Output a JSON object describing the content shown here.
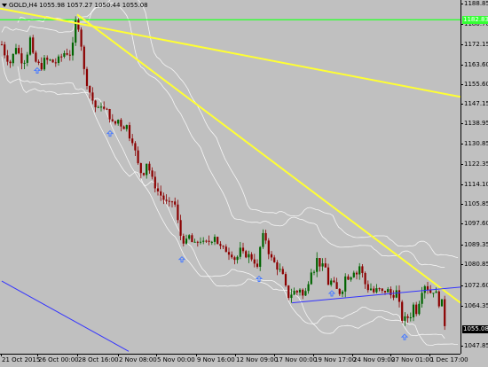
{
  "header": {
    "symbol_label": "GOLD,H4",
    "ohlc": "1055.98 1057.27 1050.44 1055.08"
  },
  "price_axis": {
    "ticks": [
      "1188.85",
      "1180.70",
      "1172.15",
      "1163.60",
      "1155.60",
      "1147.15",
      "1138.95",
      "1130.85",
      "1122.35",
      "1114.10",
      "1105.85",
      "1097.60",
      "1089.35",
      "1080.85",
      "1072.60",
      "1064.35",
      "1055.08",
      "1047.85"
    ],
    "badge_green": "1182.83",
    "badge_current": "1055.08"
  },
  "time_axis": {
    "labels": [
      "21 Oct 2015",
      "26 Oct 00:00",
      "28 Oct 16:00",
      "2 Nov 08:00",
      "5 Nov 00:00",
      "9 Nov 16:00",
      "12 Nov 09:00",
      "17 Nov 00:00",
      "19 Nov 17:00",
      "24 Nov 09:00",
      "27 Nov 01:00",
      "1 Dec 17:00"
    ]
  },
  "colors": {
    "background": "#c0c0c0",
    "bull_candle": "#006400",
    "bear_candle": "#8b0000",
    "trendline": "#ffff33",
    "horizontal_level": "#33ff33",
    "channel_line": "#3333ff",
    "bands": "#ffffff",
    "fractal_arrow": "#4a7cff"
  },
  "chart_data": {
    "type": "candlestick",
    "symbol": "GOLD",
    "timeframe": "H4",
    "ylim": [
      1045,
      1191
    ],
    "last_price": 1055.08,
    "horizontal_level": 1182.83,
    "path_points": [
      [
        0,
        1175
      ],
      [
        6,
        1168
      ],
      [
        12,
        1165
      ],
      [
        18,
        1172
      ],
      [
        22,
        1168
      ],
      [
        26,
        1165
      ],
      [
        30,
        1168
      ],
      [
        34,
        1175
      ],
      [
        38,
        1166
      ],
      [
        42,
        1165
      ],
      [
        46,
        1163
      ],
      [
        50,
        1166
      ],
      [
        56,
        1166
      ],
      [
        62,
        1165
      ],
      [
        68,
        1167
      ],
      [
        74,
        1170
      ],
      [
        78,
        1168
      ],
      [
        82,
        1172
      ],
      [
        85,
        1182
      ],
      [
        88,
        1181
      ],
      [
        91,
        1175
      ],
      [
        94,
        1163
      ],
      [
        98,
        1157
      ],
      [
        102,
        1152
      ],
      [
        106,
        1148
      ],
      [
        110,
        1145
      ],
      [
        114,
        1148
      ],
      [
        118,
        1145
      ],
      [
        122,
        1145
      ],
      [
        126,
        1140
      ],
      [
        130,
        1140
      ],
      [
        134,
        1142
      ],
      [
        138,
        1138
      ],
      [
        142,
        1140
      ],
      [
        146,
        1135
      ],
      [
        150,
        1133
      ],
      [
        154,
        1125
      ],
      [
        158,
        1120
      ],
      [
        162,
        1120
      ],
      [
        166,
        1125
      ],
      [
        170,
        1118
      ],
      [
        174,
        1115
      ],
      [
        178,
        1112
      ],
      [
        182,
        1110
      ],
      [
        186,
        1108
      ],
      [
        190,
        1106
      ],
      [
        194,
        1108
      ],
      [
        198,
        1106
      ],
      [
        202,
        1095
      ],
      [
        206,
        1092
      ],
      [
        210,
        1091
      ],
      [
        214,
        1094
      ],
      [
        218,
        1089
      ],
      [
        222,
        1091
      ],
      [
        226,
        1092
      ],
      [
        230,
        1090
      ],
      [
        234,
        1091
      ],
      [
        238,
        1092
      ],
      [
        242,
        1094
      ],
      [
        246,
        1090
      ],
      [
        250,
        1088
      ],
      [
        254,
        1088
      ],
      [
        258,
        1087
      ],
      [
        262,
        1086
      ],
      [
        266,
        1083
      ],
      [
        270,
        1088
      ],
      [
        274,
        1086
      ],
      [
        278,
        1086
      ],
      [
        282,
        1085
      ],
      [
        286,
        1084
      ],
      [
        290,
        1080
      ],
      [
        294,
        1091
      ],
      [
        298,
        1095
      ],
      [
        302,
        1088
      ],
      [
        306,
        1084
      ],
      [
        310,
        1082
      ],
      [
        314,
        1080
      ],
      [
        318,
        1078
      ],
      [
        322,
        1072
      ],
      [
        326,
        1068
      ],
      [
        330,
        1071
      ],
      [
        334,
        1070
      ],
      [
        338,
        1072
      ],
      [
        342,
        1068
      ],
      [
        346,
        1072
      ],
      [
        350,
        1080
      ],
      [
        354,
        1080
      ],
      [
        358,
        1085
      ],
      [
        362,
        1080
      ],
      [
        366,
        1082
      ],
      [
        370,
        1074
      ],
      [
        374,
        1075
      ],
      [
        378,
        1072
      ],
      [
        382,
        1070
      ],
      [
        386,
        1072
      ],
      [
        390,
        1078
      ],
      [
        394,
        1076
      ],
      [
        398,
        1080
      ],
      [
        402,
        1078
      ],
      [
        406,
        1082
      ],
      [
        410,
        1075
      ],
      [
        414,
        1072
      ],
      [
        418,
        1072
      ],
      [
        422,
        1070
      ],
      [
        426,
        1072
      ],
      [
        430,
        1070
      ],
      [
        434,
        1071
      ],
      [
        438,
        1071
      ],
      [
        442,
        1068
      ],
      [
        446,
        1072
      ],
      [
        450,
        1065
      ],
      [
        454,
        1058
      ],
      [
        458,
        1060
      ],
      [
        462,
        1060
      ],
      [
        466,
        1065
      ],
      [
        470,
        1062
      ],
      [
        474,
        1070
      ],
      [
        478,
        1074
      ],
      [
        482,
        1072
      ],
      [
        486,
        1070
      ],
      [
        490,
        1072
      ],
      [
        494,
        1066
      ],
      [
        498,
        1066
      ],
      [
        502,
        1055
      ]
    ],
    "trendlines": [
      {
        "from": [
          0,
          1187.5
        ],
        "to": [
          519,
          1151
        ]
      },
      {
        "from": [
          87,
          1185
        ],
        "to": [
          519,
          1066
        ]
      }
    ],
    "channel_lines": [
      {
        "from": [
          329,
          1066
        ],
        "to": [
          519,
          1072.5
        ]
      },
      {
        "from": [
          2,
          1075
        ],
        "to": [
          145,
          1046
        ]
      }
    ],
    "fractal_up_arrows": [
      [
        42,
        1163
      ],
      [
        124,
        1137
      ],
      [
        205,
        1085
      ],
      [
        292,
        1077
      ],
      [
        374,
        1071
      ],
      [
        456,
        1053
      ]
    ]
  }
}
